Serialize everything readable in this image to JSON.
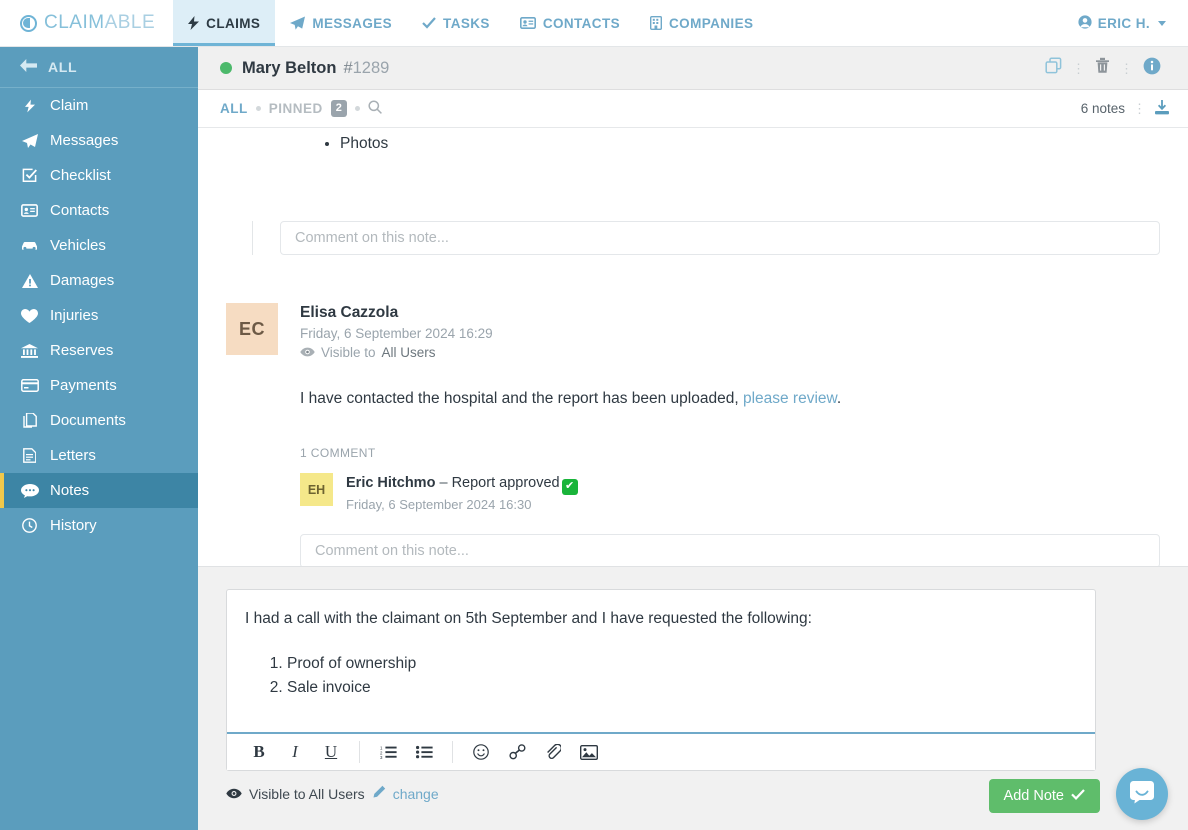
{
  "topnav": {
    "brand_prefix": "CLAIM",
    "brand_suffix": "ABLE",
    "items": [
      {
        "label": "CLAIMS",
        "icon": "bolt-icon",
        "active": true
      },
      {
        "label": "MESSAGES",
        "icon": "paper-plane-icon",
        "active": false
      },
      {
        "label": "TASKS",
        "icon": "check-icon",
        "active": false
      },
      {
        "label": "CONTACTS",
        "icon": "contact-card-icon",
        "active": false
      },
      {
        "label": "COMPANIES",
        "icon": "building-icon",
        "active": false
      }
    ],
    "user": "ERIC H."
  },
  "sidebar": {
    "back_label": "ALL",
    "items": [
      {
        "label": "Claim",
        "icon": "bolt-icon"
      },
      {
        "label": "Messages",
        "icon": "paper-plane-icon"
      },
      {
        "label": "Checklist",
        "icon": "checklist-icon"
      },
      {
        "label": "Contacts",
        "icon": "contact-card-icon"
      },
      {
        "label": "Vehicles",
        "icon": "car-icon"
      },
      {
        "label": "Damages",
        "icon": "warning-triangle-icon"
      },
      {
        "label": "Injuries",
        "icon": "heart-icon"
      },
      {
        "label": "Reserves",
        "icon": "bank-icon"
      },
      {
        "label": "Payments",
        "icon": "credit-card-icon"
      },
      {
        "label": "Documents",
        "icon": "documents-icon"
      },
      {
        "label": "Letters",
        "icon": "letter-icon"
      },
      {
        "label": "Notes",
        "icon": "comment-icon"
      },
      {
        "label": "History",
        "icon": "clock-icon"
      }
    ],
    "active_index": 11
  },
  "claimbar": {
    "status_color": "#4cb96b",
    "name": "Mary Belton",
    "hash": "#",
    "number": "1289"
  },
  "filterbar": {
    "tab_all": "ALL",
    "tab_pinned": "PINNED",
    "pinned_count": "2",
    "notes_count": "6 notes"
  },
  "feed": {
    "top_note": {
      "bullets": [
        "Photos"
      ],
      "comment_placeholder": "Comment on this note..."
    },
    "note": {
      "avatar_initials": "EC",
      "avatar_color": "#f6dcc2",
      "author": "Elisa Cazzola",
      "timestamp": "Friday, 6 September 2024 16:29",
      "visibility_prefix": "Visible to",
      "visibility_value": "All Users",
      "text_before_link": "I have contacted the hospital and the report has been uploaded,",
      "link_text": "please review",
      "text_after_link": ".",
      "comment_count_label": "1 COMMENT",
      "comments": [
        {
          "avatar_initials": "EH",
          "avatar_color": "#f5e88a",
          "author": "Eric Hitchmo",
          "dash": "–",
          "body": "Report approved",
          "emoji": "check-mark-button",
          "timestamp": "Friday, 6 September 2024 16:30"
        }
      ],
      "comment_placeholder": "Comment on this note..."
    }
  },
  "composer": {
    "line1": "I had a call with the claimant on 5th September and I have requested the following:",
    "list": [
      "Proof of ownership",
      "Sale invoice"
    ],
    "toolbar": [
      {
        "name": "bold-icon",
        "glyph": "B"
      },
      {
        "name": "italic-icon",
        "glyph": "I"
      },
      {
        "name": "underline-icon",
        "glyph": "U"
      },
      {
        "name": "ordered-list-icon",
        "glyph": ""
      },
      {
        "name": "unordered-list-icon",
        "glyph": ""
      },
      {
        "name": "emoji-icon",
        "glyph": ""
      },
      {
        "name": "link-icon",
        "glyph": ""
      },
      {
        "name": "attachment-icon",
        "glyph": ""
      },
      {
        "name": "image-icon",
        "glyph": ""
      }
    ],
    "visibility_label": "Visible to All Users",
    "change_label": "change",
    "add_note_label": "Add Note",
    "accent_color": "#5fbd6b"
  }
}
